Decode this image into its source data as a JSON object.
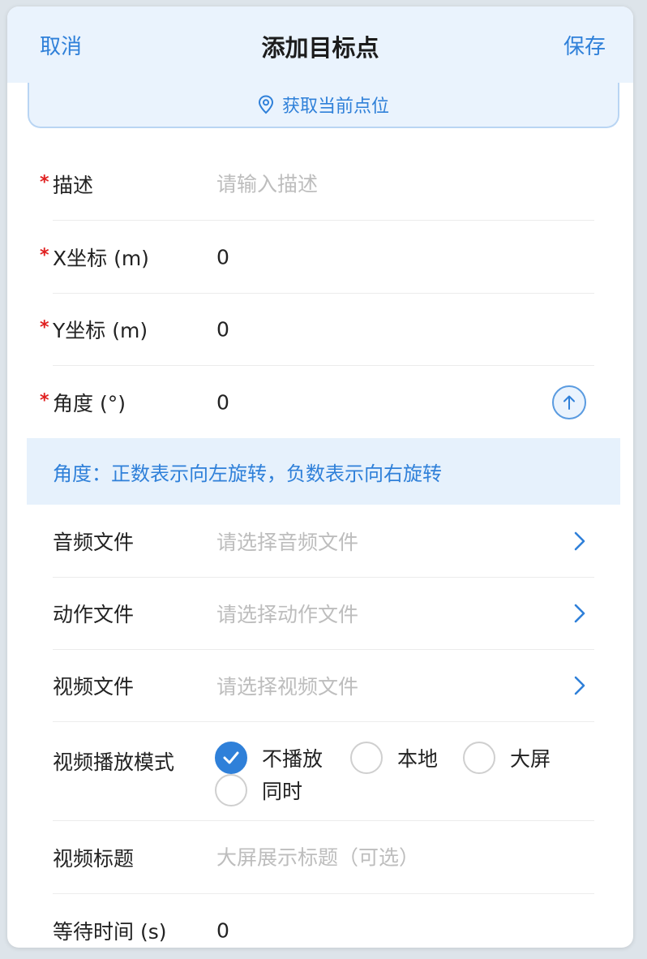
{
  "header": {
    "cancel_label": "取消",
    "title": "添加目标点",
    "save_label": "保存"
  },
  "locate_button": {
    "label": "获取当前点位",
    "icon": "location-pin-icon"
  },
  "fields": {
    "description": {
      "label": "描述",
      "placeholder": "请输入描述",
      "value": "",
      "required": true
    },
    "x": {
      "label": "X坐标 (m)",
      "value": "0",
      "required": true
    },
    "y": {
      "label": "Y坐标 (m)",
      "value": "0",
      "required": true
    },
    "angle": {
      "label": "角度 (°)",
      "value": "0",
      "required": true,
      "icon": "arrow-up-circle-icon"
    },
    "angle_tip": "角度：正数表示向左旋转，负数表示向右旋转",
    "audio": {
      "label": "音频文件",
      "placeholder": "请选择音频文件"
    },
    "action": {
      "label": "动作文件",
      "placeholder": "请选择动作文件"
    },
    "video": {
      "label": "视频文件",
      "placeholder": "请选择视频文件"
    },
    "play_mode": {
      "label": "视频播放模式",
      "options": [
        "不播放",
        "本地",
        "大屏",
        "同时"
      ],
      "selected": "不播放"
    },
    "video_title": {
      "label": "视频标题",
      "placeholder": "大屏展示标题（可选）"
    },
    "wait_time": {
      "label": "等待时间 (s)",
      "value": "0"
    }
  },
  "colors": {
    "accent": "#2f80d9",
    "header_bg": "#eaf3fd",
    "required": "#e02020",
    "placeholder": "#bdbdbd"
  }
}
